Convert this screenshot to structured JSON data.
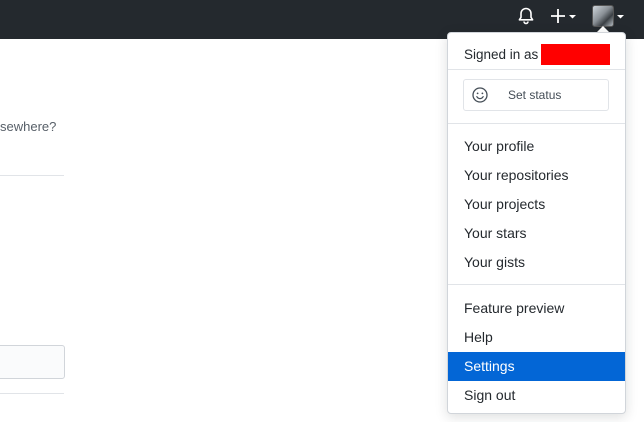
{
  "header": {
    "icons": [
      "bell-icon",
      "plus-icon",
      "caret-down-icon",
      "avatar",
      "caret-down-icon"
    ]
  },
  "background": {
    "text_fragment": "sewhere?"
  },
  "user_menu": {
    "signed_in_label": "Signed in as",
    "status_button_label": "Set status",
    "status_icon": "smiley-icon",
    "group1": [
      "Your profile",
      "Your repositories",
      "Your projects",
      "Your stars",
      "Your gists"
    ],
    "group2": [
      "Feature preview",
      "Help",
      "Settings",
      "Sign out"
    ],
    "active_item": "Settings",
    "colors": {
      "active_bg": "#0366d6",
      "redaction": "#ff0000",
      "topbar": "#24292e"
    }
  }
}
